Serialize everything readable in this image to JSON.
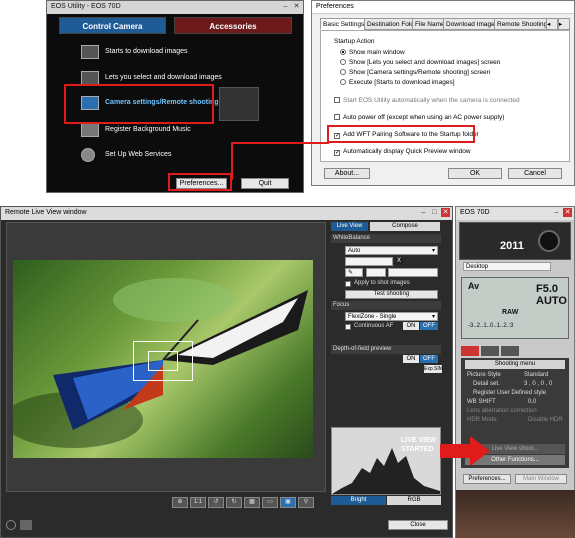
{
  "eos_utility": {
    "title": "EOS Utility - EOS 70D",
    "tabs": [
      "Control Camera",
      "Accessories"
    ],
    "menu": [
      {
        "label": "Starts to download images",
        "icon": "download-icon"
      },
      {
        "label": "Lets you select and download images",
        "icon": "select-download-icon"
      },
      {
        "label": "Camera settings/Remote shooting",
        "icon": "remote-shooting-icon"
      },
      {
        "label": "Register Background Music",
        "icon": "music-icon"
      },
      {
        "label": "Set Up Web Services",
        "icon": "globe-icon"
      }
    ],
    "preferences_button": "Preferences...",
    "quit_button": "Quit"
  },
  "preferences": {
    "title": "Preferences",
    "tabs": [
      "Basic Settings",
      "Destination Folder",
      "File Name",
      "Download Images",
      "Remote Shooting"
    ],
    "startup_action_label": "Startup Action",
    "radios": [
      "Show main window",
      "Show [Lets you select and download images] screen",
      "Show [Camera settings/Remote shooting] screen",
      "Execute [Starts to download images]"
    ],
    "checkboxes": [
      "Start EOS Utility automatically when the camera is connected",
      "Auto power off (except when using an AC power supply)",
      "Add WFT Pairing Software to the Startup folder",
      "Automatically display Quick Preview window"
    ],
    "about_button": "About...",
    "ok_button": "OK",
    "cancel_button": "Cancel"
  },
  "live_view": {
    "title": "Remote Live View window",
    "tabs": [
      "Live View",
      "Compose"
    ],
    "white_balance_label": "WhiteBalance",
    "wb_value": "Auto",
    "apply_label": "Apply to shot images",
    "test_shooting": "Test shooting",
    "focus_label": "Focus",
    "focus_mode": "FlexiZone - Single",
    "continuous_af": "Continuous AF",
    "depth_label": "Depth-of-field preview",
    "on": "ON",
    "off": "OFF",
    "exp_sim": "Exp.SIM",
    "histogram_tabs": [
      "Bright",
      "RGB"
    ],
    "close_button": "Close",
    "annotation": "LIVE VIEW STARTED",
    "annotation_color": "#e01b1b"
  },
  "camera_panel": {
    "title": "EOS 70D",
    "year": "2011",
    "desktop": "Desktop",
    "aperture": "F5.0",
    "iso": "AUTO",
    "raw": "RAW",
    "av": "Av",
    "scale": "-3..2..1..0..1..2.:3",
    "shooting_menu": "Shooting menu",
    "rows": [
      {
        "label": "Picture Style",
        "value": "Standard"
      },
      {
        "label": "Detail set.",
        "value": "3 , 0 , 0 , 0"
      },
      {
        "label": "Register User Defined style",
        "value": ""
      },
      {
        "label": "WB SHIFT",
        "value": "0,0"
      },
      {
        "label": "Lens aberration correction",
        "value": ""
      },
      {
        "label": "HDR Mode",
        "value": "Disable HDR"
      }
    ],
    "live_view_shoot": "Live View shoot...",
    "other_functions": "Other Functions...",
    "preferences": "Preferences...",
    "main_window": "Main Window"
  }
}
